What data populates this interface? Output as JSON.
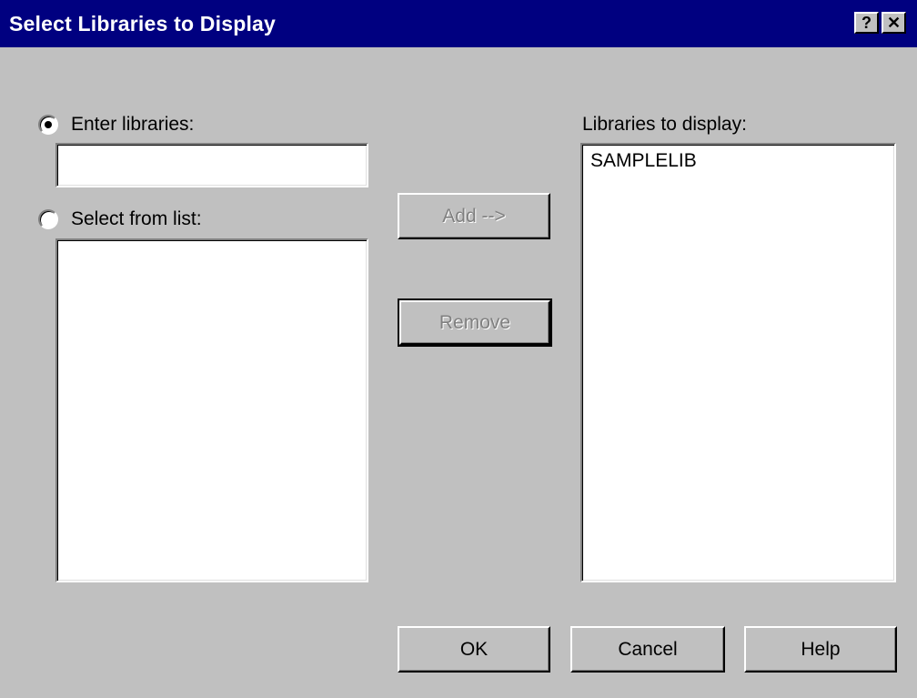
{
  "dialog": {
    "title": "Select Libraries to Display",
    "help_glyph": "?",
    "close_glyph": "✕"
  },
  "left": {
    "enter_radio_label": "Enter libraries:",
    "enter_radio_checked": true,
    "enter_input_value": "",
    "select_radio_label": "Select from list:",
    "select_radio_checked": false,
    "select_list_items": []
  },
  "middle": {
    "add_label": "Add -->",
    "remove_label": "Remove"
  },
  "right": {
    "label": "Libraries to display:",
    "items": [
      "SAMPLELIB"
    ]
  },
  "footer": {
    "ok_label": "OK",
    "cancel_label": "Cancel",
    "help_label": "Help"
  },
  "colors": {
    "titlebar": "#000080",
    "face": "#c0c0c0",
    "disabled_text": "#808080"
  }
}
